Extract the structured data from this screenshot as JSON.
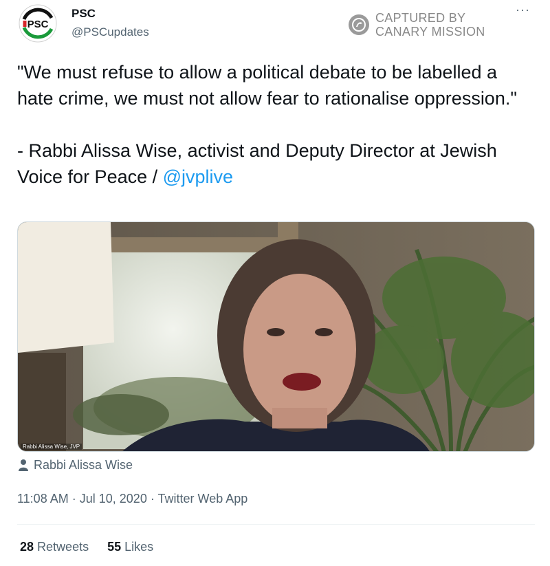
{
  "author": {
    "display_name": "PSC",
    "handle": "@PSCupdates",
    "avatar_text": "PSC"
  },
  "watermark": {
    "line1": "CAPTURED BY",
    "line2": "CANARY MISSION"
  },
  "more_menu": "···",
  "tweet": {
    "quote": "\"We must refuse to allow a political debate to be labelled a hate crime, we must not allow fear to rationalise oppression.\"",
    "attribution_prefix": "- Rabbi Alissa Wise, activist and Deputy Director at Jewish Voice for Peace / ",
    "mention": "@jvplive"
  },
  "media": {
    "overlay_caption": "Rabbi Alissa Wise, JVP"
  },
  "tagged_person": "Rabbi Alissa Wise",
  "meta": {
    "time": "11:08 AM",
    "date": "Jul 10, 2020",
    "source": "Twitter Web App",
    "separator": "·"
  },
  "stats": {
    "retweets_count": "28",
    "retweets_label": "Retweets",
    "likes_count": "55",
    "likes_label": "Likes"
  }
}
